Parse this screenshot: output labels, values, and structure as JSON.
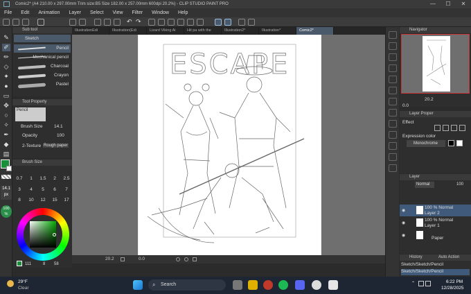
{
  "window": {
    "title": "Comic2* (A4 210.00 x 297.00mm Trim size:B5 Size 182.00 x 257.00mm 600dpi 20.2%) - CLIP STUDIO PAINT PRO",
    "minimize": "—",
    "maximize": "☐",
    "close": "✕"
  },
  "menu": [
    "File",
    "Edit",
    "Animation",
    "Layer",
    "Select",
    "View",
    "Filter",
    "Window",
    "Help"
  ],
  "document_tabs": [
    {
      "label": "IllustrationEdi"
    },
    {
      "label": "Illustration(Edi"
    },
    {
      "label": "Lizard Viking Ai"
    },
    {
      "label": "Hit pa with the"
    },
    {
      "label": "Illustration2*"
    },
    {
      "label": "Illustration*"
    },
    {
      "label": "Comic2*"
    }
  ],
  "sub_tool": {
    "header": "Sub tool",
    "group": "Sketch",
    "brushes": [
      "Pencil",
      "Mechanical pencil",
      "Charcoal",
      "Crayon",
      "Pastel"
    ],
    "selected": "Pencil"
  },
  "tool_property": {
    "header": "Tool Property",
    "tool_name": "Pencil",
    "brush_size_label": "Brush Size",
    "brush_size_value": "14.1",
    "opacity_label": "Opacity",
    "opacity_value": "100",
    "texture_label": "2-Texture",
    "texture_value": "Rough paper"
  },
  "brush_size_panel": {
    "header": "Brush Size",
    "sizes": [
      "0.7",
      "1",
      "1.5",
      "2",
      "2.5",
      "3",
      "4",
      "5",
      "6",
      "7",
      "8",
      "10",
      "12",
      "15",
      "17"
    ]
  },
  "left_indicators": {
    "size": "14.1",
    "unit": "px",
    "opacity": "100",
    "opacity_unit": "%"
  },
  "color_panel": {
    "status": "111",
    "values": [
      "8",
      "58"
    ]
  },
  "canvas": {
    "sketch_title_text": "ESCAPE"
  },
  "status_bar": {
    "zoom": "20.2",
    "angle": "0.0"
  },
  "navigator": {
    "header": "Navigator",
    "zoom": "20.2",
    "angle": "0.0"
  },
  "layer_property": {
    "header": "Layer Proper",
    "effect_label": "Effect",
    "expression_color_label": "Expression color",
    "expression_color_value": "Monochrome"
  },
  "layer_panel": {
    "header": "Layer",
    "blend_mode": "Normal",
    "opacity": "100",
    "layers": [
      {
        "line1": "100 % Normal",
        "line2": "Layer 2",
        "selected": true
      },
      {
        "line1": "100 % Normal",
        "line2": "Layer 1",
        "selected": false
      },
      {
        "line1": "",
        "line2": "Paper",
        "selected": false
      }
    ]
  },
  "history": {
    "header": "History",
    "header2": "Auto Action",
    "items": [
      "Sketch/Sketch/Pencil",
      "Sketch/Sketch/Pencil"
    ]
  },
  "taskbar": {
    "weather_temp": "29°F",
    "weather_cond": "Clear",
    "search_placeholder": "Search",
    "time": "6:22 PM",
    "date": "12/28/2025"
  },
  "colors": {
    "main_color": "#1a8f3a",
    "accent": "#4b5a6a",
    "selection": "#3f5a7a"
  }
}
